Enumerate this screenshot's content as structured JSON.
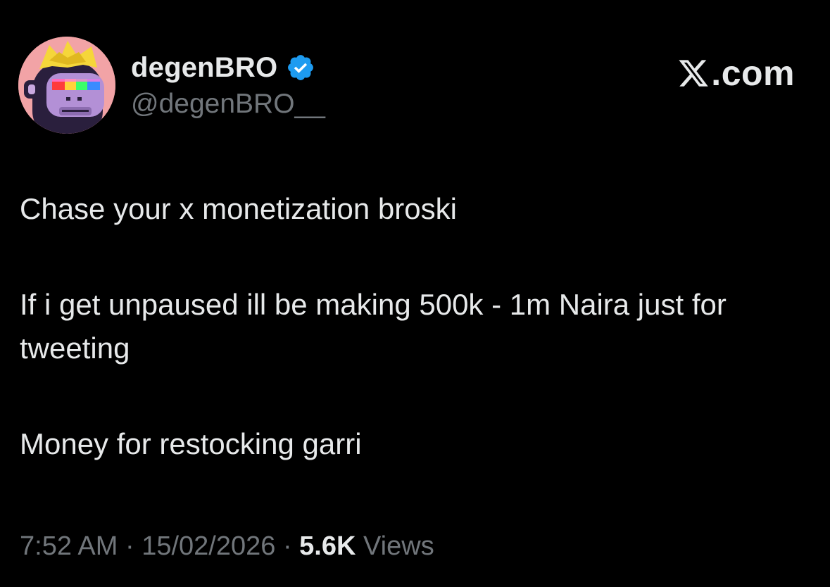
{
  "author": {
    "display_name": "degenBRO",
    "handle": "@degenBRO__",
    "verified": true,
    "avatar_icon": "pixel-ape-avatar-icon"
  },
  "brand": {
    "text": "com",
    "icon": "x-logo-icon"
  },
  "tweet": {
    "paragraphs": [
      "Chase your x monetization broski",
      "If i get unpaused ill be making 500k - 1m Naira just for tweeting",
      "Money for restocking garri"
    ]
  },
  "meta": {
    "time": "7:52 AM",
    "date": "15/02/2026",
    "separator": "·",
    "views_count": "5.6K",
    "views_label": "Views"
  },
  "colors": {
    "background": "#000000",
    "text_primary": "#e7e9ea",
    "text_secondary": "#71767b",
    "verified_blue": "#1d9bf0"
  }
}
